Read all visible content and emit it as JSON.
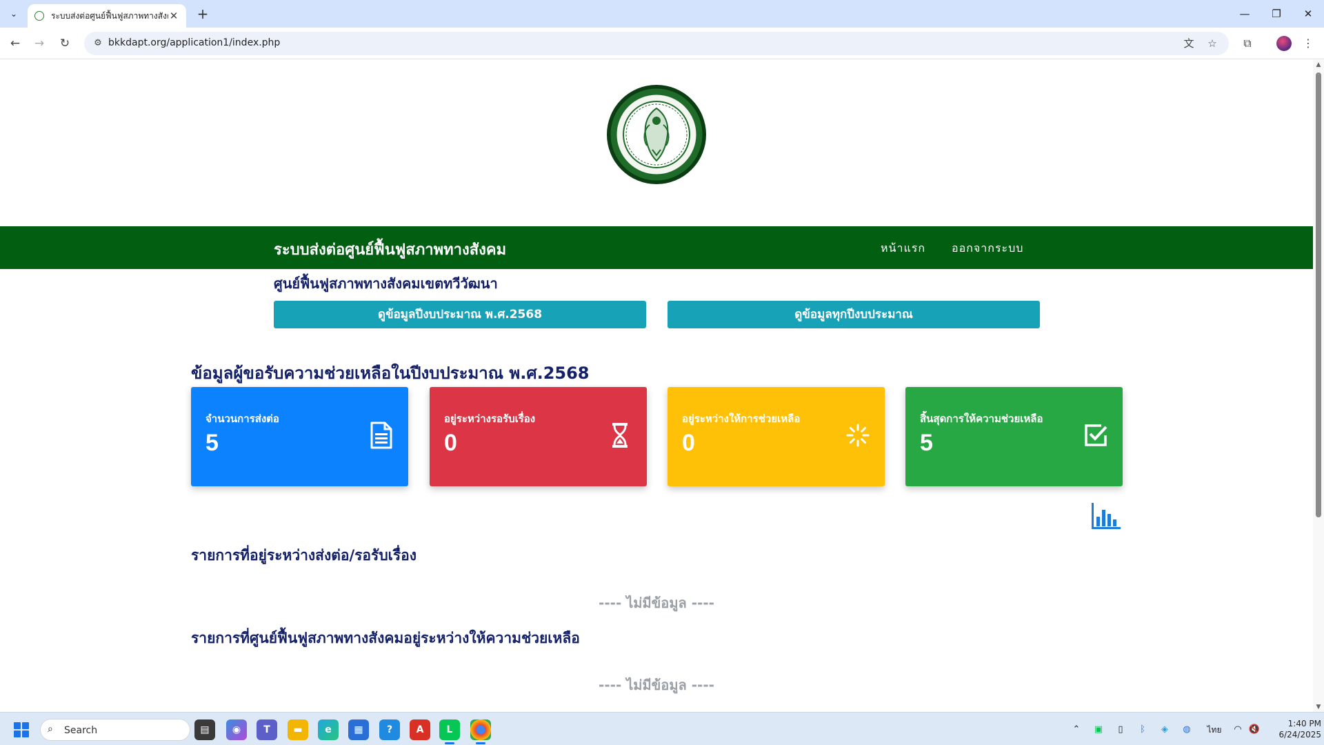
{
  "browser": {
    "tab_title": "ระบบส่งต่อศูนย์ฟื้นฟูสภาพทางสังคม",
    "url": "bkkdapt.org/application1/index.php"
  },
  "navbar": {
    "brand": "ระบบส่งต่อศูนย์ฟื้นฟูสภาพทางสังคม",
    "links": [
      "หน้าแรก",
      "ออกจากระบบ"
    ]
  },
  "center_name": "ศูนย์ฟื้นฟูสภาพทางสังคมเขตทวีวัฒนา",
  "buttons": {
    "current_year": "ดูข้อมูลปีงบประมาณ พ.ศ.2568",
    "all_years": "ดูข้อมูลทุกปีงบประมาณ"
  },
  "summary": {
    "title": "ข้อมูลผู้ขอรับความช่วยเหลือในปีงบประมาณ พ.ศ.2568",
    "cards": [
      {
        "label": "จำนวนการส่งต่อ",
        "value": "5",
        "color": "#0d82ff",
        "icon": "document-icon"
      },
      {
        "label": "อยู่ระหว่างรอรับเรื่อง",
        "value": "0",
        "color": "#dc3545",
        "icon": "hourglass-icon"
      },
      {
        "label": "อยู่ระหว่างให้การช่วยเหลือ",
        "value": "0",
        "color": "#ffc107",
        "icon": "spinner-icon"
      },
      {
        "label": "สิ้นสุดการให้ความช่วยเหลือ",
        "value": "5",
        "color": "#28a745",
        "icon": "check-square-icon"
      }
    ]
  },
  "sections": [
    {
      "title": "รายการที่อยู่ระหว่างส่งต่อ/รอรับเรื่อง",
      "empty_text": "---- ไม่มีข้อมูล ----"
    },
    {
      "title": "รายการที่ศูนย์ฟื้นฟูสภาพทางสังคมอยู่ระหว่างให้ความช่วยเหลือ",
      "empty_text": "---- ไม่มีข้อมูล ----"
    }
  ],
  "taskbar": {
    "search_placeholder": "Search",
    "language": "ไทย",
    "time": "1:40 PM",
    "date": "6/24/2025"
  }
}
